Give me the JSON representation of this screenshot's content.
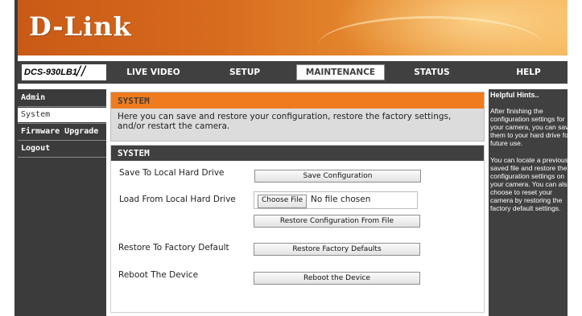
{
  "brand": {
    "logo": "D-Link"
  },
  "nav": {
    "model": "DCS-930LB1",
    "tabs": [
      {
        "label": "LIVE VIDEO"
      },
      {
        "label": "SETUP"
      },
      {
        "label": "MAINTENANCE"
      },
      {
        "label": "STATUS"
      },
      {
        "label": "HELP"
      }
    ],
    "active_tab": "MAINTENANCE"
  },
  "sidebar": {
    "items": [
      {
        "label": "Admin"
      },
      {
        "label": "System"
      },
      {
        "label": "Firmware Upgrade"
      },
      {
        "label": "Logout"
      }
    ],
    "active_item": "System"
  },
  "main": {
    "intro_title": "SYSTEM",
    "intro_text": "Here you can save and restore your configuration, restore the factory settings, and/or restart the camera.",
    "form_title": "SYSTEM",
    "rows": {
      "save_label": "Save To Local Hard Drive",
      "save_button": "Save Configuration",
      "load_label": "Load From Local Hard Drive",
      "choose_file_button": "Choose File",
      "file_status": "No file chosen",
      "restore_file_button": "Restore Configuration From File",
      "factory_label": "Restore To Factory Default",
      "factory_button": "Restore Factory Defaults",
      "reboot_label": "Reboot The Device",
      "reboot_button": "Reboot the Device"
    }
  },
  "hints": {
    "title": "Helpful Hints..",
    "lines1": [
      "After finishing the",
      "configuration settings for",
      "your camera, you can save",
      "them to your hard drive for",
      "future use."
    ],
    "lines2": [
      "You can locate a previously",
      "saved file and restore the",
      "configuration settings on",
      "your camera. You can also",
      "choose to reset your",
      "camera by restoring the",
      "factory default settings."
    ]
  },
  "colors": {
    "accent_orange": "#f07b1e",
    "nav_dark": "#404040"
  }
}
